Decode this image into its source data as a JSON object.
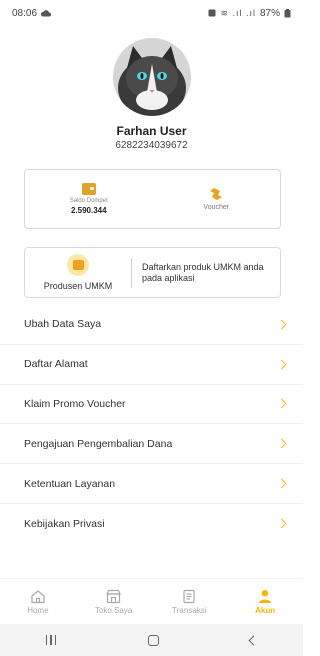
{
  "status_bar": {
    "time": "08:06",
    "battery": "87%"
  },
  "profile": {
    "name": "Farhan User",
    "phone": "6282234039672"
  },
  "wallet": {
    "label": "Saldo Dompet",
    "value": "2.590.344",
    "voucher_label": "Voucher"
  },
  "umkm": {
    "label": "Produsen UMKM",
    "description": "Daftarkan produk UMKM anda pada aplikasi"
  },
  "menu": [
    {
      "label": "Ubah Data Saya"
    },
    {
      "label": "Daftar Alamat"
    },
    {
      "label": "Klaim Promo Voucher"
    },
    {
      "label": "Pengajuan Pengembalian Dana"
    },
    {
      "label": "Ketentuan Layanan"
    },
    {
      "label": "Kebijakan Privasi"
    }
  ],
  "bottom_nav": [
    {
      "label": "Home",
      "icon": "home-icon",
      "active": false
    },
    {
      "label": "Toko Saya",
      "icon": "store-icon",
      "active": false
    },
    {
      "label": "Transaksi",
      "icon": "receipt-icon",
      "active": false
    },
    {
      "label": "Akun",
      "icon": "user-icon",
      "active": true
    }
  ],
  "colors": {
    "accent": "#F2B705",
    "wallet_icon": "#E0A32A"
  }
}
